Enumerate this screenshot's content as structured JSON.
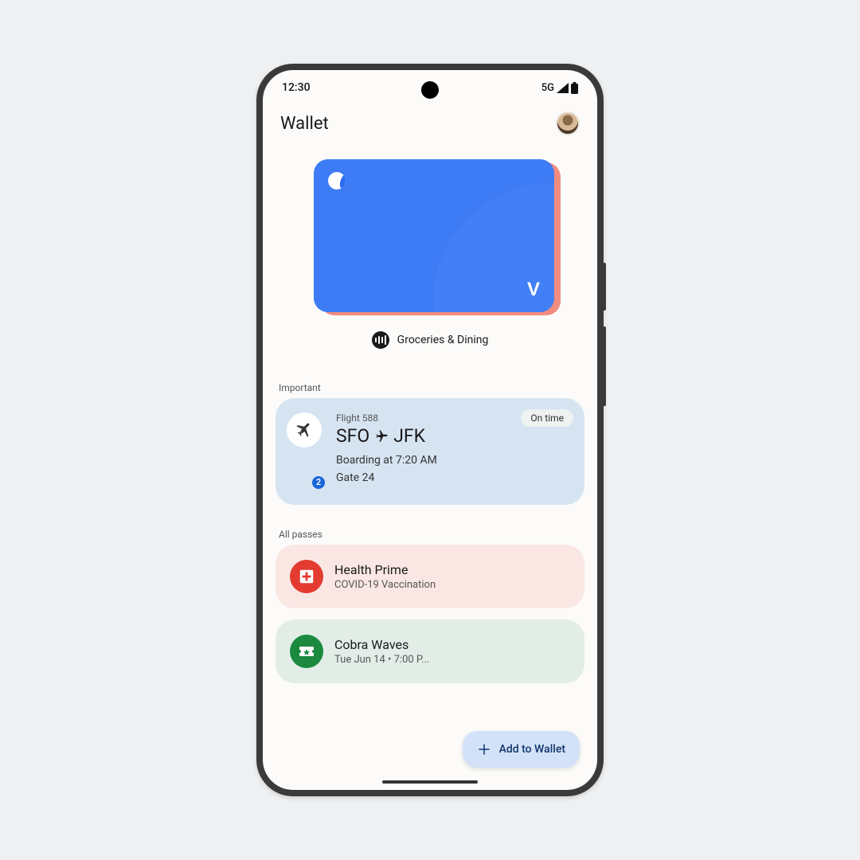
{
  "status": {
    "time": "12:30",
    "network": "5G"
  },
  "header": {
    "title": "Wallet"
  },
  "card": {
    "label": "Groceries & Dining"
  },
  "important": {
    "section_label": "Important",
    "flight_label": "Flight 588",
    "badge_count": "2",
    "from": "SFO",
    "to": "JFK",
    "boarding": "Boarding at 7:20 AM",
    "gate": "Gate 24",
    "status": "On time"
  },
  "all_passes": {
    "section_label": "All passes",
    "items": [
      {
        "title": "Health Prime",
        "subtitle": "COVID-19 Vaccination"
      },
      {
        "title": "Cobra Waves",
        "subtitle": "Tue Jun 14 • 7:00 P..."
      }
    ]
  },
  "fab": {
    "label": "Add to Wallet"
  }
}
